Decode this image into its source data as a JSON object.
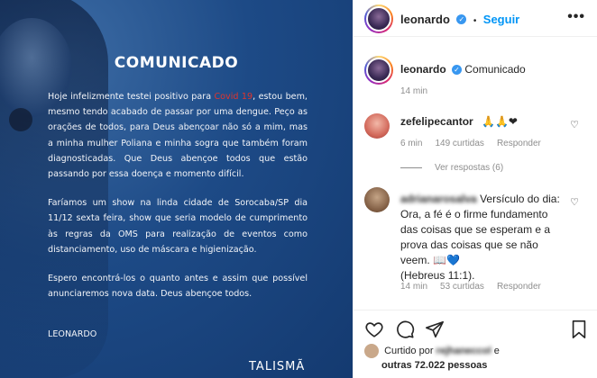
{
  "post_image": {
    "heading": "COMUNICADO",
    "paragraph1_before": "Hoje infelizmente testei positivo para ",
    "paragraph1_highlight": "Covid 19",
    "paragraph1_after": ", estou bem, mesmo tendo acabado de passar por uma dengue. Peço as orações de todos, para Deus abençoar não só a mim, mas a minha mulher Poliana e minha sogra que também foram diagnosticadas. Que Deus abençoe todos que estão passando por essa doença e momento difícil.",
    "paragraph2": "Faríamos um show na linda cidade de Sorocaba/SP dia 11/12 sexta feira, show que seria modelo de cumprimento às regras da OMS para realização de eventos como distanciamento, uso de máscara e higienização.",
    "paragraph3": "Espero encontrá-los o quanto antes e assim que possível anunciaremos nova data. Deus abençoe todos.",
    "signature": "LEONARDO",
    "logo": "TALISMÃ"
  },
  "header": {
    "username": "leonardo",
    "separator": "•",
    "follow_label": "Seguir",
    "more_label": "•••"
  },
  "caption": {
    "username": "leonardo",
    "text": "Comunicado",
    "time": "14 min"
  },
  "comments": [
    {
      "username": "zefelipecantor",
      "text": "🙏🙏❤",
      "time": "6 min",
      "likes": "149 curtidas",
      "reply_label": "Responder",
      "view_replies": "Ver respostas (6)"
    },
    {
      "username": "adrianarosalva",
      "text_lines": [
        "Versículo do dia:",
        "Ora, a fé é o firme fundamento",
        "das coisas que se esperam e a",
        "prova das coisas que se não",
        "veem. 📖💙",
        "(Hebreus 11:1)."
      ],
      "time": "14 min",
      "likes": "53 curtidas",
      "reply_label": "Responder"
    }
  ],
  "likes": {
    "prefix": "Curtido por",
    "user": "rejhaneccol",
    "conjunction": "e",
    "others": "outras 72.022 pessoas"
  },
  "colors": {
    "accent": "#0095f6",
    "covid_red": "#e0342c",
    "verified": "#3897f0",
    "post_bg": "#1d4a86"
  },
  "icons": [
    "verified-icon",
    "heart-icon",
    "comment-icon",
    "share-icon",
    "bookmark-icon"
  ]
}
